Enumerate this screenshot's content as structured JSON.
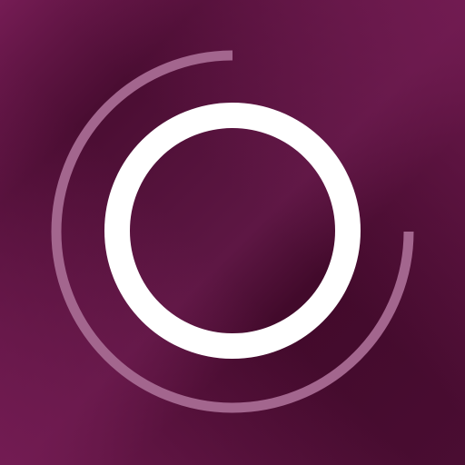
{
  "icon": {
    "name": "ring-logo",
    "colors": {
      "background_light": "#751c54",
      "background_mid": "#5e1744",
      "background_dark": "#420a2b",
      "ring": "#ffffff",
      "arc": "#a3668e"
    }
  }
}
